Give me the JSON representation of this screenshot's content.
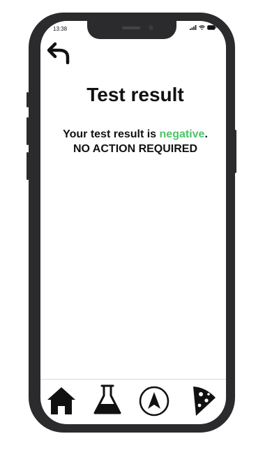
{
  "status_bar": {
    "time": "13:38",
    "icons": [
      "signal-icon",
      "wifi-icon",
      "battery-icon"
    ]
  },
  "header": {
    "back_icon": "back-arrow-icon",
    "title": "Test result"
  },
  "result": {
    "prefix": "Your test result is ",
    "status": "negative",
    "suffix": ".",
    "action": "NO ACTION REQUIRED",
    "status_color": "#4fc36a"
  },
  "tab_bar": {
    "items": [
      {
        "icon": "home-icon"
      },
      {
        "icon": "lab-flask-icon"
      },
      {
        "icon": "navigation-compass-icon"
      },
      {
        "icon": "pizza-slice-icon"
      }
    ]
  }
}
